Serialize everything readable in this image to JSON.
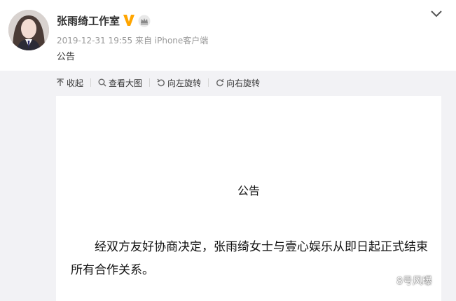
{
  "post": {
    "username": "张雨绮工作室",
    "timestamp": "2019-12-31 19:55",
    "source": "来自 iPhone客户端",
    "text": "公告",
    "icons": {
      "avatar": "avatar",
      "verified": "verified-v-icon",
      "member": "crown-icon",
      "menu": "chevron-down-icon"
    }
  },
  "toolbar": {
    "items": [
      {
        "icon": "collapse-up-icon",
        "label": "收起"
      },
      {
        "icon": "search-icon",
        "label": "查看大图"
      },
      {
        "icon": "rotate-left-icon",
        "label": "向左旋转"
      },
      {
        "icon": "rotate-right-icon",
        "label": "向右旋转"
      }
    ]
  },
  "image": {
    "title": "公告",
    "body": "经双方友好协商决定，张雨绮女士与壹心娱乐从即日起正式结束所有合作关系。"
  },
  "watermark": {
    "text": "8号风曝",
    "icon": "wechat-icon"
  },
  "colors": {
    "verified": "#ffa500",
    "background": "#f2f2f5"
  }
}
